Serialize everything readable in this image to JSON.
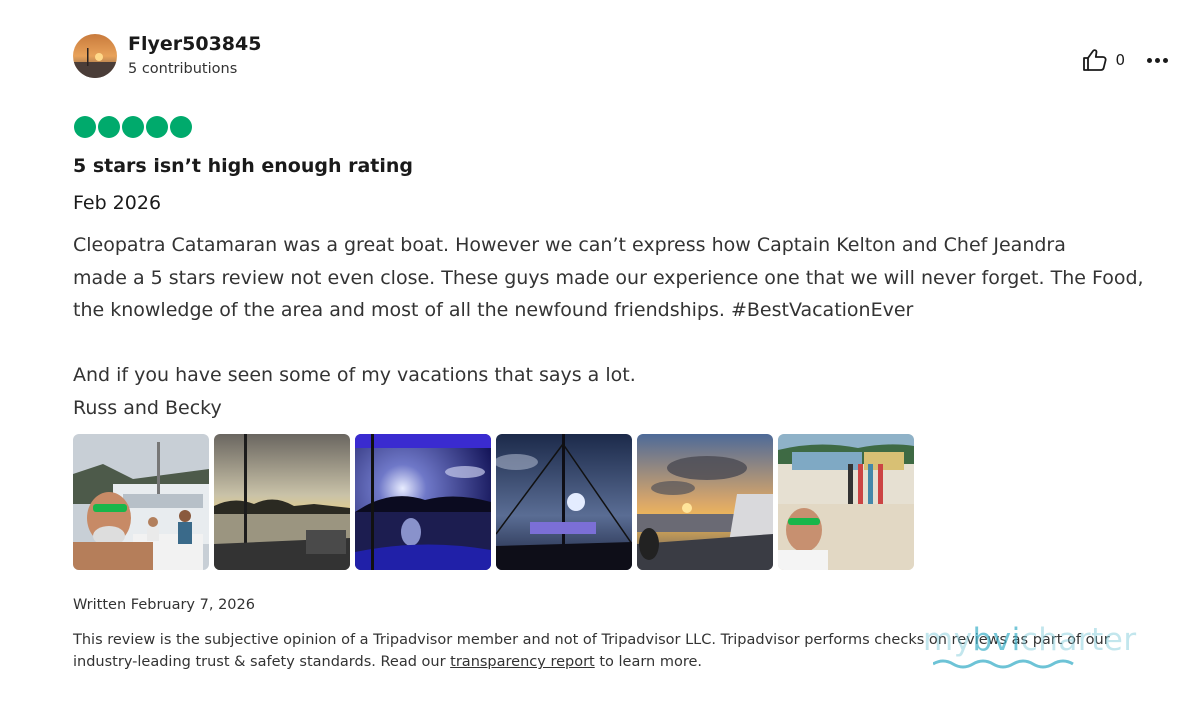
{
  "reviewer": {
    "name": "Flyer503845",
    "contributions": "5 contributions"
  },
  "actions": {
    "helpful_count": "0",
    "helpful_icon": "thumbs-up-icon",
    "more_icon": "more-dots-icon"
  },
  "review": {
    "rating": 5,
    "rating_color": "#00aa6c",
    "title": "5 stars isn’t high enough rating",
    "date": "Feb 2026",
    "body_lines": [
      "Cleopatra Catamaran was a great boat. However we can’t express how Captain Kelton and Chef Jeandra",
      "made a 5 stars review not even close. These guys made our experience one that we will never forget. The Food,",
      "the knowledge of the area and most of all the newfound friendships. #BestVacationEver",
      "And if you have seen some of my vacations that says a lot.",
      "Russ and Becky"
    ]
  },
  "footer": {
    "written": "Written February 7, 2026",
    "disclaimer_text": "This review is the subjective opinion of a Tripadvisor member and not of Tripadvisor LLC. Tripadvisor performs checks on reviews as part of our",
    "disclaimer_line2_pre": "industry-leading trust & safety standards. Read our",
    "transparency_link": "transparency report",
    "disclaimer_line2_post": "to learn more."
  },
  "watermark": {
    "prefix": "my",
    "brand": "bvi",
    "suffix": "charter"
  }
}
